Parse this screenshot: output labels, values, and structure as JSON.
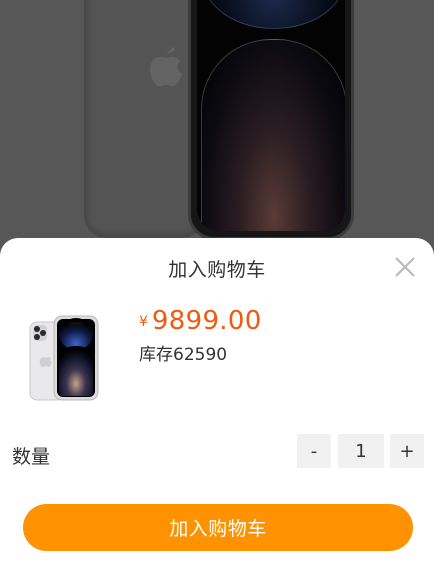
{
  "sheet": {
    "title": "加入购物车",
    "close_icon": "close-icon"
  },
  "product": {
    "image_icon": "iphone-product-image",
    "currency_symbol": "¥",
    "price": "9899.00",
    "stock": "库存62590"
  },
  "quantity": {
    "label": "数量",
    "minus_label": "-",
    "value": "1",
    "plus_label": "+"
  },
  "actions": {
    "add_to_cart_label": "加入购物车"
  },
  "colors": {
    "accent": "#ff9200",
    "price": "#f25a0e",
    "overlay": "#575757"
  }
}
